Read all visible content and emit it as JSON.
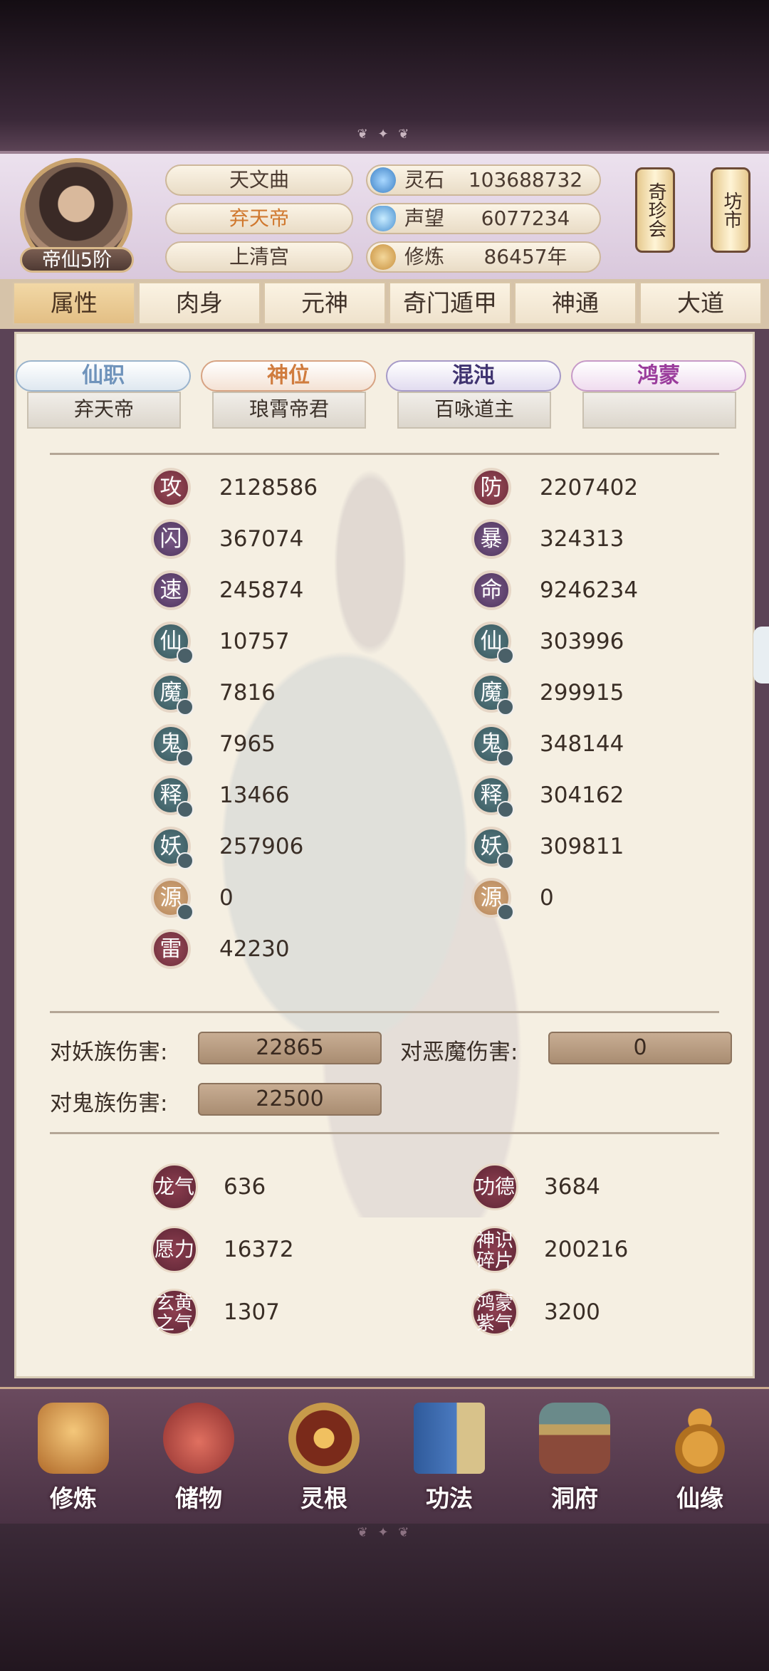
{
  "header": {
    "rank": "帝仙5阶",
    "names": [
      "天文曲",
      "弃天帝",
      "上清宫"
    ],
    "resources": [
      {
        "icon": "spirit-stone-icon",
        "label": "灵石",
        "value": "103688732"
      },
      {
        "icon": "crystal-icon",
        "label": "声望",
        "value": "6077234"
      },
      {
        "icon": "meditation-icon",
        "label": "修炼",
        "value": "86457年"
      }
    ],
    "side_buttons": [
      "奇珍会",
      "坊市"
    ]
  },
  "tabs": [
    "属性",
    "肉身",
    "元神",
    "奇门遁甲",
    "神通",
    "大道"
  ],
  "ranks": [
    {
      "title": "仙职",
      "value": "弃天帝",
      "color": "#7fa0c0"
    },
    {
      "title": "神位",
      "value": "琅霄帝君",
      "color": "#d08a4a"
    },
    {
      "title": "混沌",
      "value": "百咏道主",
      "color": "#5a4a8a"
    },
    {
      "title": "鸿蒙",
      "value": "",
      "color": "#a04aa0"
    }
  ],
  "stats_left": [
    {
      "glyph": "攻",
      "value": "2128586",
      "style": "red",
      "dot": false
    },
    {
      "glyph": "闪",
      "value": "367074",
      "style": "purple",
      "dot": false
    },
    {
      "glyph": "速",
      "value": "245874",
      "style": "purple",
      "dot": false
    },
    {
      "glyph": "仙",
      "value": "10757",
      "style": "teal",
      "dot": true
    },
    {
      "glyph": "魔",
      "value": "7816",
      "style": "teal",
      "dot": true
    },
    {
      "glyph": "鬼",
      "value": "7965",
      "style": "teal",
      "dot": true
    },
    {
      "glyph": "释",
      "value": "13466",
      "style": "teal",
      "dot": true
    },
    {
      "glyph": "妖",
      "value": "257906",
      "style": "teal",
      "dot": true
    },
    {
      "glyph": "源",
      "value": "0",
      "style": "tan",
      "dot": true
    },
    {
      "glyph": "雷",
      "value": "42230",
      "style": "red",
      "dot": false
    }
  ],
  "stats_right": [
    {
      "glyph": "防",
      "value": "2207402",
      "style": "red",
      "dot": false
    },
    {
      "glyph": "暴",
      "value": "324313",
      "style": "purple",
      "dot": false
    },
    {
      "glyph": "命",
      "value": "9246234",
      "style": "purple",
      "dot": false
    },
    {
      "glyph": "仙",
      "value": "303996",
      "style": "teal",
      "dot": true
    },
    {
      "glyph": "魔",
      "value": "299915",
      "style": "teal",
      "dot": true
    },
    {
      "glyph": "鬼",
      "value": "348144",
      "style": "teal",
      "dot": true
    },
    {
      "glyph": "释",
      "value": "304162",
      "style": "teal",
      "dot": true
    },
    {
      "glyph": "妖",
      "value": "309811",
      "style": "teal",
      "dot": true
    },
    {
      "glyph": "源",
      "value": "0",
      "style": "tan",
      "dot": true
    }
  ],
  "damage": [
    {
      "label": "对妖族伤害:",
      "value": "22865"
    },
    {
      "label": "对恶魔伤害:",
      "value": "0"
    },
    {
      "label": "对鬼族伤害:",
      "value": "22500"
    }
  ],
  "bonus": [
    {
      "label": "龙气",
      "value": "636"
    },
    {
      "label": "功德",
      "value": "3684"
    },
    {
      "label": "愿力",
      "value": "16372"
    },
    {
      "label": "神识碎片",
      "value": "200216"
    },
    {
      "label": "玄黄之气",
      "value": "1307"
    },
    {
      "label": "鸿蒙紫气",
      "value": "3200"
    }
  ],
  "bottom_nav": [
    {
      "label": "修炼",
      "icon": "cultivation-icon"
    },
    {
      "label": "储物",
      "icon": "storage-bag-icon"
    },
    {
      "label": "灵根",
      "icon": "spirit-root-icon"
    },
    {
      "label": "功法",
      "icon": "technique-book-icon"
    },
    {
      "label": "洞府",
      "icon": "cave-dwelling-icon"
    },
    {
      "label": "仙缘",
      "icon": "gourd-icon"
    }
  ]
}
